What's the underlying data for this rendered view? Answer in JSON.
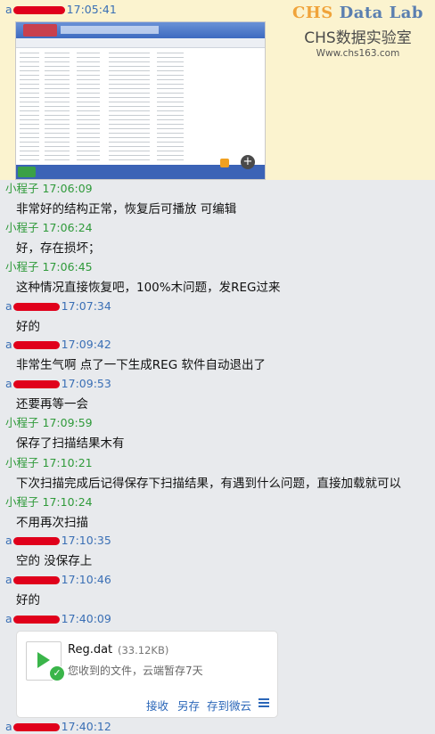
{
  "watermark": {
    "line1_a": "CHS",
    "line1_b": " Data Lab",
    "line2": "CHS数据实验室",
    "line3": "Www.chs163.com"
  },
  "messages": [
    {
      "sender": "a",
      "time": "17:05:41",
      "type": "image",
      "self": false
    },
    {
      "sender": "小程子",
      "time": "17:06:09",
      "text": "非常好的结构正常，恢复后可播放 可编辑",
      "self": true
    },
    {
      "sender": "小程子",
      "time": "17:06:24",
      "text": "好，存在损坏；",
      "self": true
    },
    {
      "sender": "小程子",
      "time": "17:06:45",
      "text": "这种情况直接恢复吧，100%木问题，发REG过来",
      "self": true
    },
    {
      "sender": "a",
      "time": "17:07:34",
      "text": "好的",
      "self": false
    },
    {
      "sender": "a",
      "time": "17:09:42",
      "text": "非常生气啊  点了一下生成REG 软件自动退出了",
      "self": false
    },
    {
      "sender": "a",
      "time": "17:09:53",
      "text": "还要再等一会",
      "self": false
    },
    {
      "sender": "小程子",
      "time": "17:09:59",
      "text": "保存了扫描结果木有",
      "self": true
    },
    {
      "sender": "小程子",
      "time": "17:10:21",
      "text": "下次扫描完成后记得保存下扫描结果，有遇到什么问题，直接加载就可以",
      "self": true
    },
    {
      "sender": "小程子",
      "time": "17:10:24",
      "text": "不用再次扫描",
      "self": true
    },
    {
      "sender": "a",
      "time": "17:10:35",
      "text": "空的 没保存上",
      "self": false
    },
    {
      "sender": "a",
      "time": "17:10:46",
      "text": "好的",
      "self": false
    },
    {
      "sender": "a",
      "time": "17:40:09",
      "type": "file",
      "self": false
    },
    {
      "sender": "a",
      "time": "17:40:12",
      "type": "partial",
      "self": false
    }
  ],
  "file": {
    "name": "Reg.dat",
    "size": "(33.12KB)",
    "note": "您收到的文件，云端暂存7天",
    "actions": [
      "接收",
      "另存",
      "存到微云"
    ]
  },
  "colors": {
    "self_name": "#2f9a3a",
    "other_name": "#3a6fb5",
    "link": "#2a66b8",
    "redaction": "#e0001b"
  }
}
